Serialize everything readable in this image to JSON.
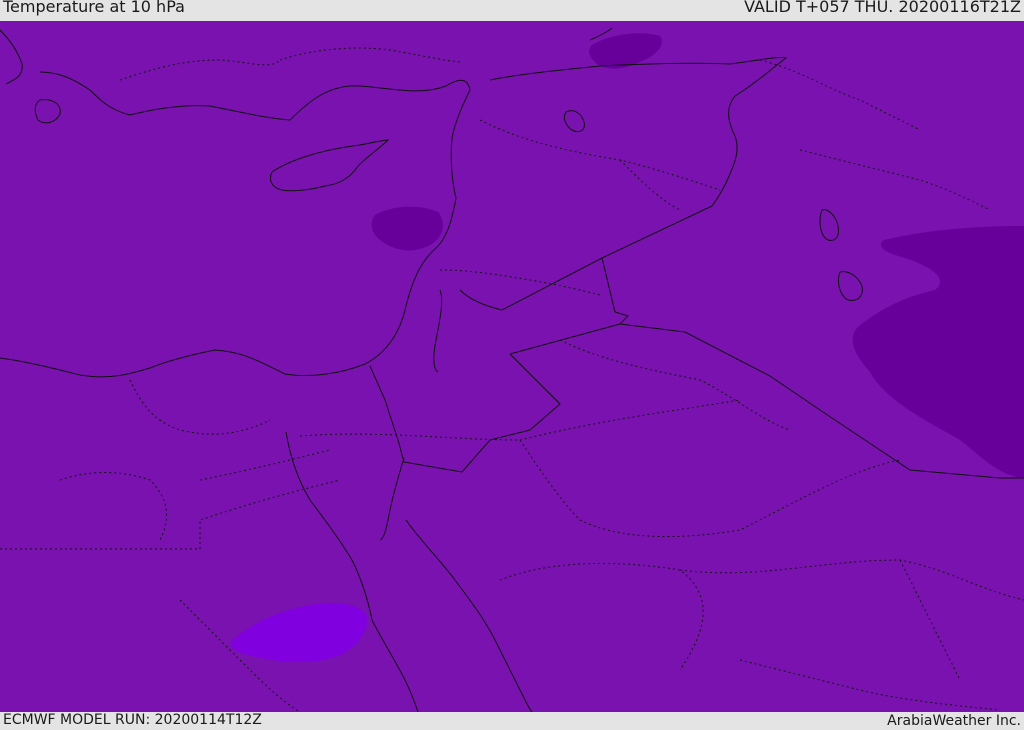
{
  "header": {
    "title": "Temperature at 10 hPa",
    "valid": "VALID T+057 THU. 20200116T21Z"
  },
  "footer": {
    "model_run": "ECMWF MODEL RUN: 20200114T12Z",
    "credit": "ArabiaWeather Inc."
  },
  "map": {
    "base_color": "#7a12b0",
    "cold_color": "#67009b",
    "warm_color": "#8000e0",
    "border_color": "#111111"
  }
}
